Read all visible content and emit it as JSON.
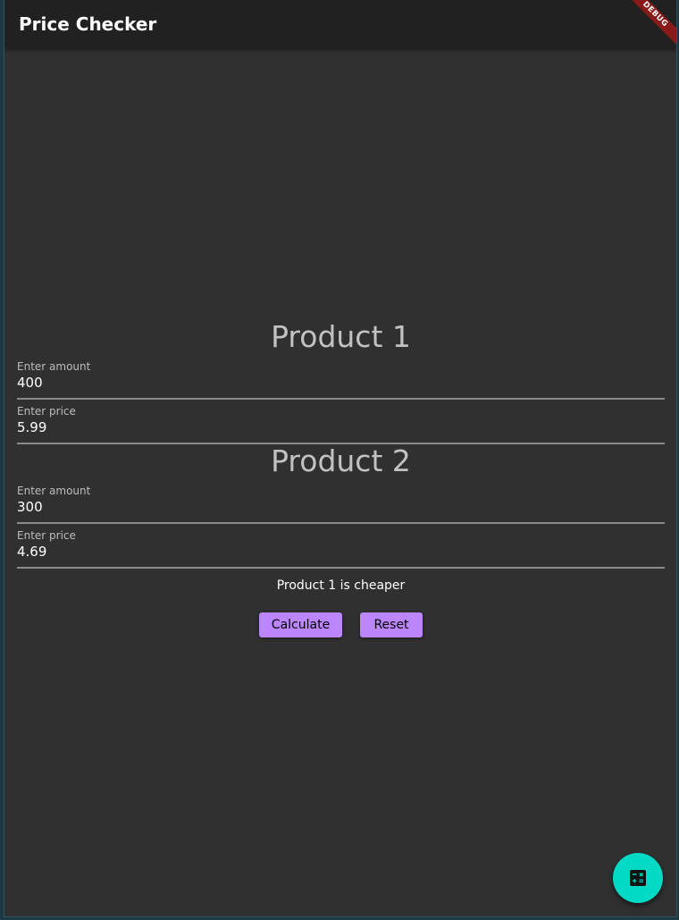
{
  "appbar": {
    "title": "Price Checker",
    "debug_banner": "DEBUG"
  },
  "product1": {
    "heading": "Product 1",
    "amount_label": "Enter amount",
    "amount_value": "400",
    "price_label": "Enter price",
    "price_value": "5.99"
  },
  "product2": {
    "heading": "Product 2",
    "amount_label": "Enter amount",
    "amount_value": "300",
    "price_label": "Enter price",
    "price_value": "4.69"
  },
  "result_text": "Product 1 is cheaper",
  "buttons": {
    "calculate": "Calculate",
    "reset": "Reset"
  },
  "fab": {
    "icon": "calculate-icon"
  },
  "colors": {
    "background": "#303030",
    "appbar": "#212121",
    "button": "#bb86fc",
    "fab": "#03dac5"
  }
}
